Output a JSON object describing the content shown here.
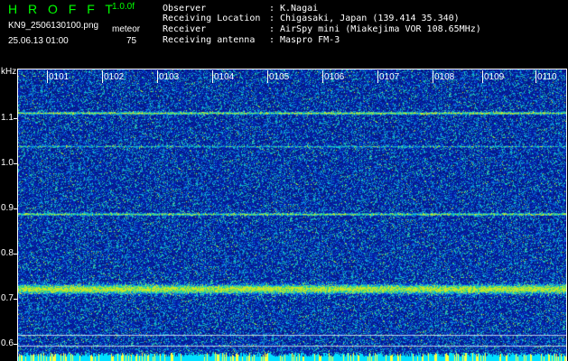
{
  "header": {
    "app_title": "H R O F F T",
    "version": "1.0.0f",
    "filename": "KN9_2506130100.png",
    "mode": "meteor",
    "datetime": "25.06.13 01:00",
    "level": "75"
  },
  "info": [
    {
      "label": "Observer",
      "value": "K.Nagai"
    },
    {
      "label": "Receiving Location",
      "value": "Chigasaki, Japan (139.414 35.340)"
    },
    {
      "label": "Receiver",
      "value": "AirSpy mini (Miakejima VOR 108.65MHz)"
    },
    {
      "label": "Receiving antenna",
      "value": "Maspro FM-3"
    }
  ],
  "separator": ":",
  "axes": {
    "y_unit": "kHz",
    "y_ticks": [
      "1.1",
      "1.0",
      "0.9",
      "0.8",
      "0.7",
      "0.6"
    ],
    "x_ticks": [
      "0101",
      "0102",
      "0103",
      "0104",
      "0105",
      "0106",
      "0107",
      "0108",
      "0109",
      "0110"
    ]
  },
  "colors": {
    "title": "#00ff00",
    "text": "#ffffff",
    "background": "#000000",
    "noise_base": "#0a1fa8",
    "carrier": "#20e0c0",
    "cyan_floor": "#00e0ff"
  }
}
